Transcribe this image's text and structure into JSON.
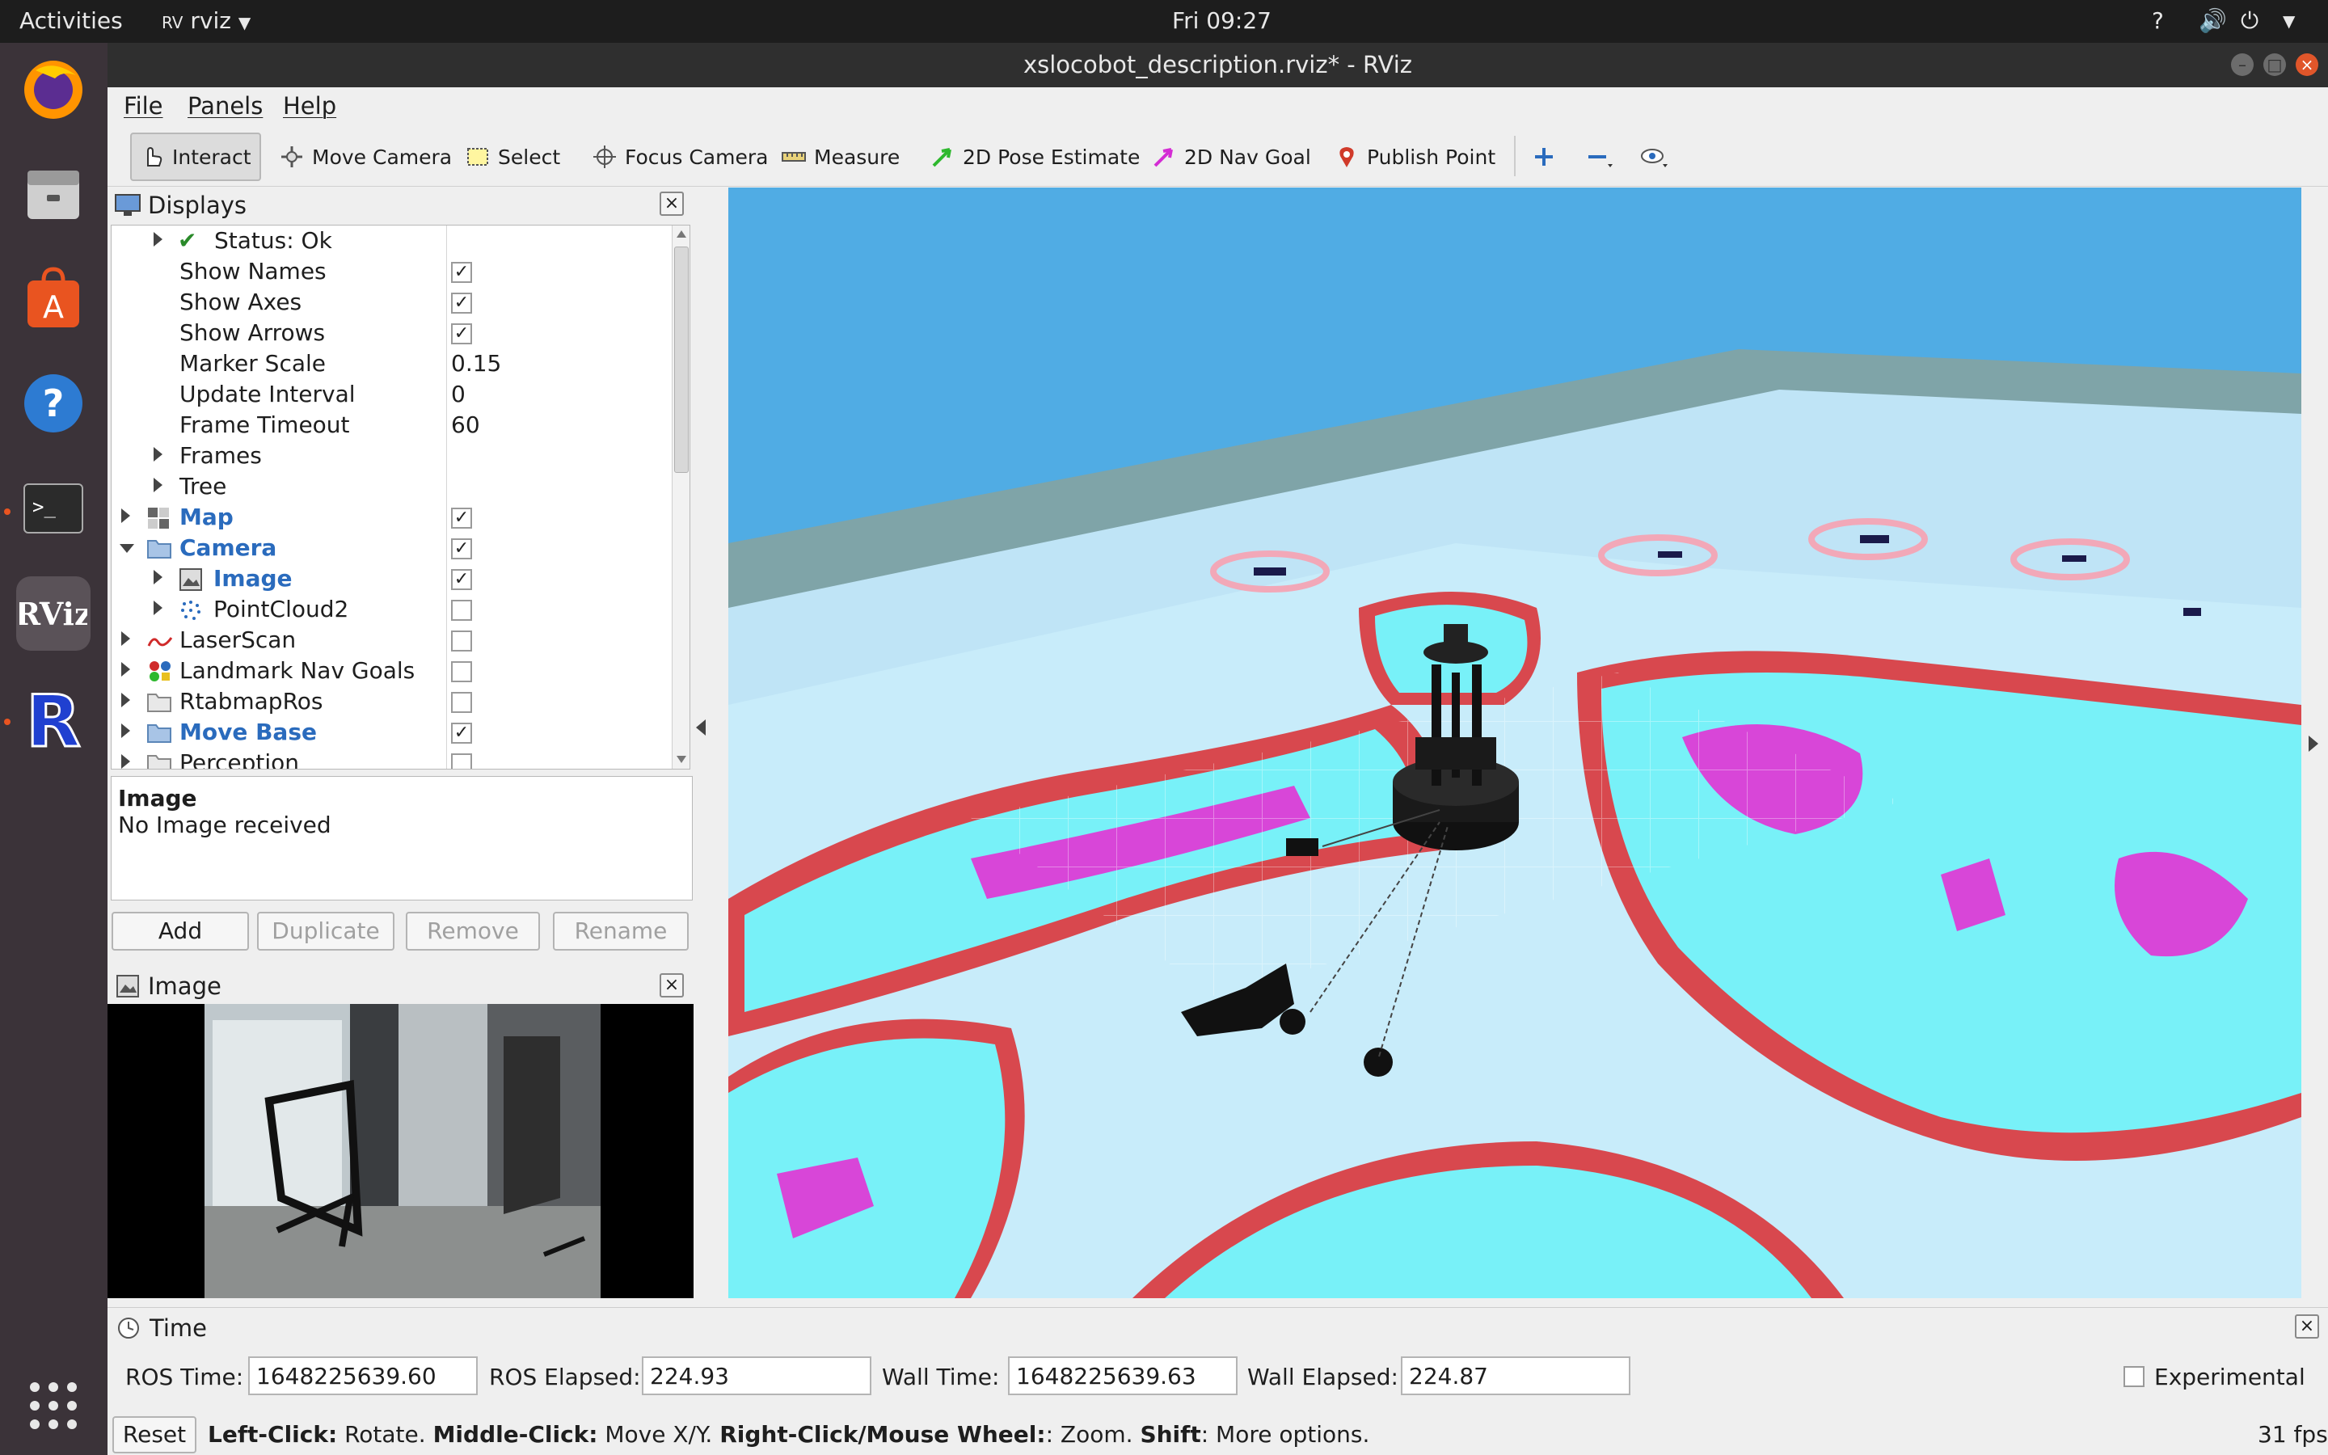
{
  "topbar": {
    "activities": "Activities",
    "app_name": "rviz",
    "clock": "Fri 09:27"
  },
  "window": {
    "title": "xslocobot_description.rviz* - RViz"
  },
  "menubar": {
    "file": "File",
    "panels": "Panels",
    "help": "Help"
  },
  "toolbar": {
    "interact": "Interact",
    "move_camera": "Move Camera",
    "select": "Select",
    "focus_camera": "Focus Camera",
    "measure": "Measure",
    "pose_estimate": "2D Pose Estimate",
    "nav_goal": "2D Nav Goal",
    "publish_point": "Publish Point"
  },
  "displays": {
    "title": "Displays",
    "rows": [
      {
        "label": "Status: Ok"
      },
      {
        "label": "Show Names"
      },
      {
        "label": "Show Axes"
      },
      {
        "label": "Show Arrows"
      },
      {
        "label": "Marker Scale",
        "value": "0.15"
      },
      {
        "label": "Update Interval",
        "value": "0"
      },
      {
        "label": "Frame Timeout",
        "value": "60"
      },
      {
        "label": "Frames"
      },
      {
        "label": "Tree"
      },
      {
        "label": "Map"
      },
      {
        "label": "Camera"
      },
      {
        "label": "Image"
      },
      {
        "label": "PointCloud2"
      },
      {
        "label": "LaserScan"
      },
      {
        "label": "Landmark Nav Goals"
      },
      {
        "label": "RtabmapRos"
      },
      {
        "label": "Move Base"
      },
      {
        "label": "Perception"
      }
    ],
    "description_title": "Image",
    "description_text": "No Image received",
    "buttons": {
      "add": "Add",
      "duplicate": "Duplicate",
      "remove": "Remove",
      "rename": "Rename"
    }
  },
  "image_panel": {
    "title": "Image"
  },
  "time_panel": {
    "title": "Time",
    "ros_time_label": "ROS Time:",
    "ros_time": "1648225639.60",
    "ros_elapsed_label": "ROS Elapsed:",
    "ros_elapsed": "224.93",
    "wall_time_label": "Wall Time:",
    "wall_time": "1648225639.63",
    "wall_elapsed_label": "Wall Elapsed:",
    "wall_elapsed": "224.87",
    "experimental": "Experimental"
  },
  "statusbar": {
    "reset": "Reset",
    "left_click": "Left-Click:",
    "left_click_desc": " Rotate. ",
    "middle_click": "Middle-Click:",
    "middle_click_desc": " Move X/Y. ",
    "right_click": "Right-Click/Mouse Wheel:",
    "right_click_desc": ": Zoom. ",
    "shift": "Shift",
    "shift_desc": ": More options.",
    "fps": "31 fps"
  }
}
